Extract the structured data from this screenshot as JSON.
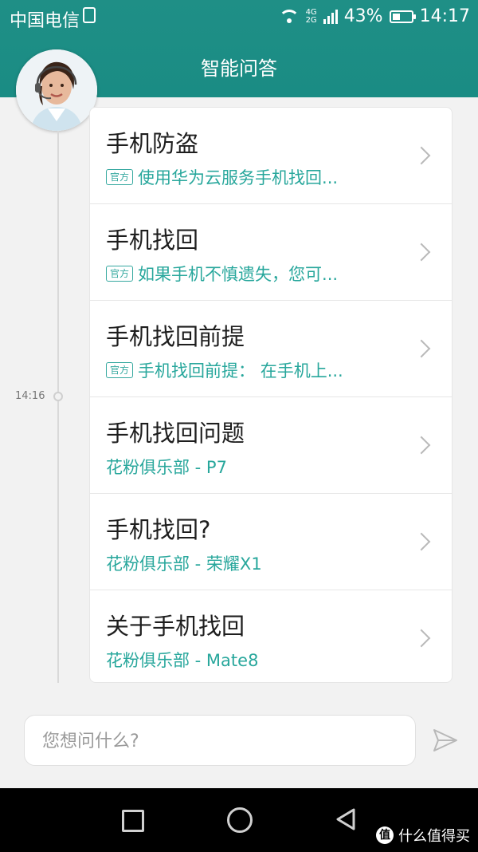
{
  "status_bar": {
    "carrier": "中国电信",
    "network": "4G",
    "network2": "2G",
    "battery": "43%",
    "battery_level": 0.43,
    "time": "14:17"
  },
  "header": {
    "title": "智能问答"
  },
  "timeline": {
    "time": "14:16"
  },
  "results": [
    {
      "question": "手机防盗",
      "tag": "官方",
      "snippet": "使用华为云服务手机找回..."
    },
    {
      "question": "手机找回",
      "tag": "官方",
      "snippet": "如果手机不慎遗失，您可..."
    },
    {
      "question": "手机找回前提",
      "tag": "官方",
      "snippet": "手机找回前提： 在手机上..."
    },
    {
      "question": "手机找回问题",
      "tag": "",
      "snippet": "花粉俱乐部 - P7"
    },
    {
      "question": "手机找回?",
      "tag": "",
      "snippet": "花粉俱乐部 - 荣耀X1"
    },
    {
      "question": "关于手机找回",
      "tag": "",
      "snippet": "花粉俱乐部 - Mate8"
    }
  ],
  "input": {
    "placeholder": "您想问什么?",
    "value": ""
  },
  "watermark": {
    "badge": "值",
    "text": "什么值得买"
  },
  "colors": {
    "header": "#1a8c84",
    "accent": "#28a79c"
  }
}
